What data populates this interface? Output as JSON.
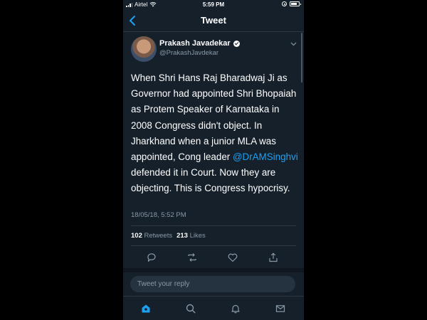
{
  "status_bar": {
    "carrier": "Airtel",
    "time": "5:59 PM"
  },
  "nav": {
    "title": "Tweet"
  },
  "tweet": {
    "author_name": "Prakash Javadekar",
    "author_handle": "@PrakashJavdekar",
    "text_before": "When Shri Hans Raj Bharadwaj Ji as Governor had appointed Shri Bhopaiah as Protem Speaker of Karnataka in 2008 Congress didn't object. In Jharkhand when a junior MLA was appointed, Cong leader ",
    "mention": "@DrAMSinghvi",
    "text_after": " defended it in Court. Now they are objecting. This is Congress hypocrisy.",
    "timestamp": "18/05/18, 5:52 PM",
    "retweets_count": "102",
    "retweets_label": "Retweets",
    "likes_count": "213",
    "likes_label": "Likes"
  },
  "reply": {
    "placeholder": "Tweet your reply"
  },
  "colors": {
    "background": "#15202b",
    "accent": "#1da1f2",
    "muted": "#8899a6"
  }
}
